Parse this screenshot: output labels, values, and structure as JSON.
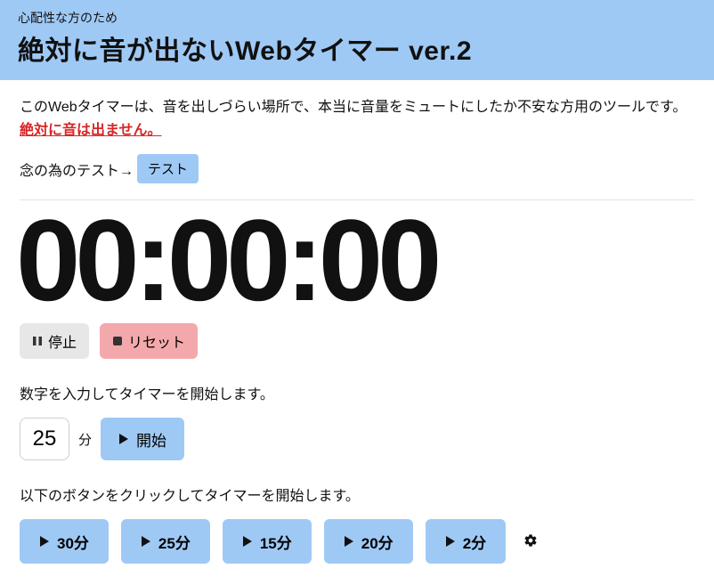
{
  "header": {
    "subtitle": "心配性な方のため",
    "title": "絶対に音が出ないWebタイマー ver.2"
  },
  "intro": {
    "desc": "このWebタイマーは、音を出しづらい場所で、本当に音量をミュートにしたか不安な方用のツールです。",
    "link": "絶対に音は出ません。",
    "test_label": "念の為のテスト→",
    "test_button": "テスト"
  },
  "timer": {
    "display": "00:00:00"
  },
  "controls": {
    "pause_label": "停止",
    "reset_label": "リセット"
  },
  "input_section": {
    "label": "数字を入力してタイマーを開始します。",
    "value": "25",
    "unit": "分",
    "start_label": "開始"
  },
  "preset_section": {
    "label": "以下のボタンをクリックしてタイマーを開始します。",
    "buttons": [
      {
        "label": "30分"
      },
      {
        "label": "25分"
      },
      {
        "label": "15分"
      },
      {
        "label": "20分"
      },
      {
        "label": "2分"
      }
    ]
  }
}
